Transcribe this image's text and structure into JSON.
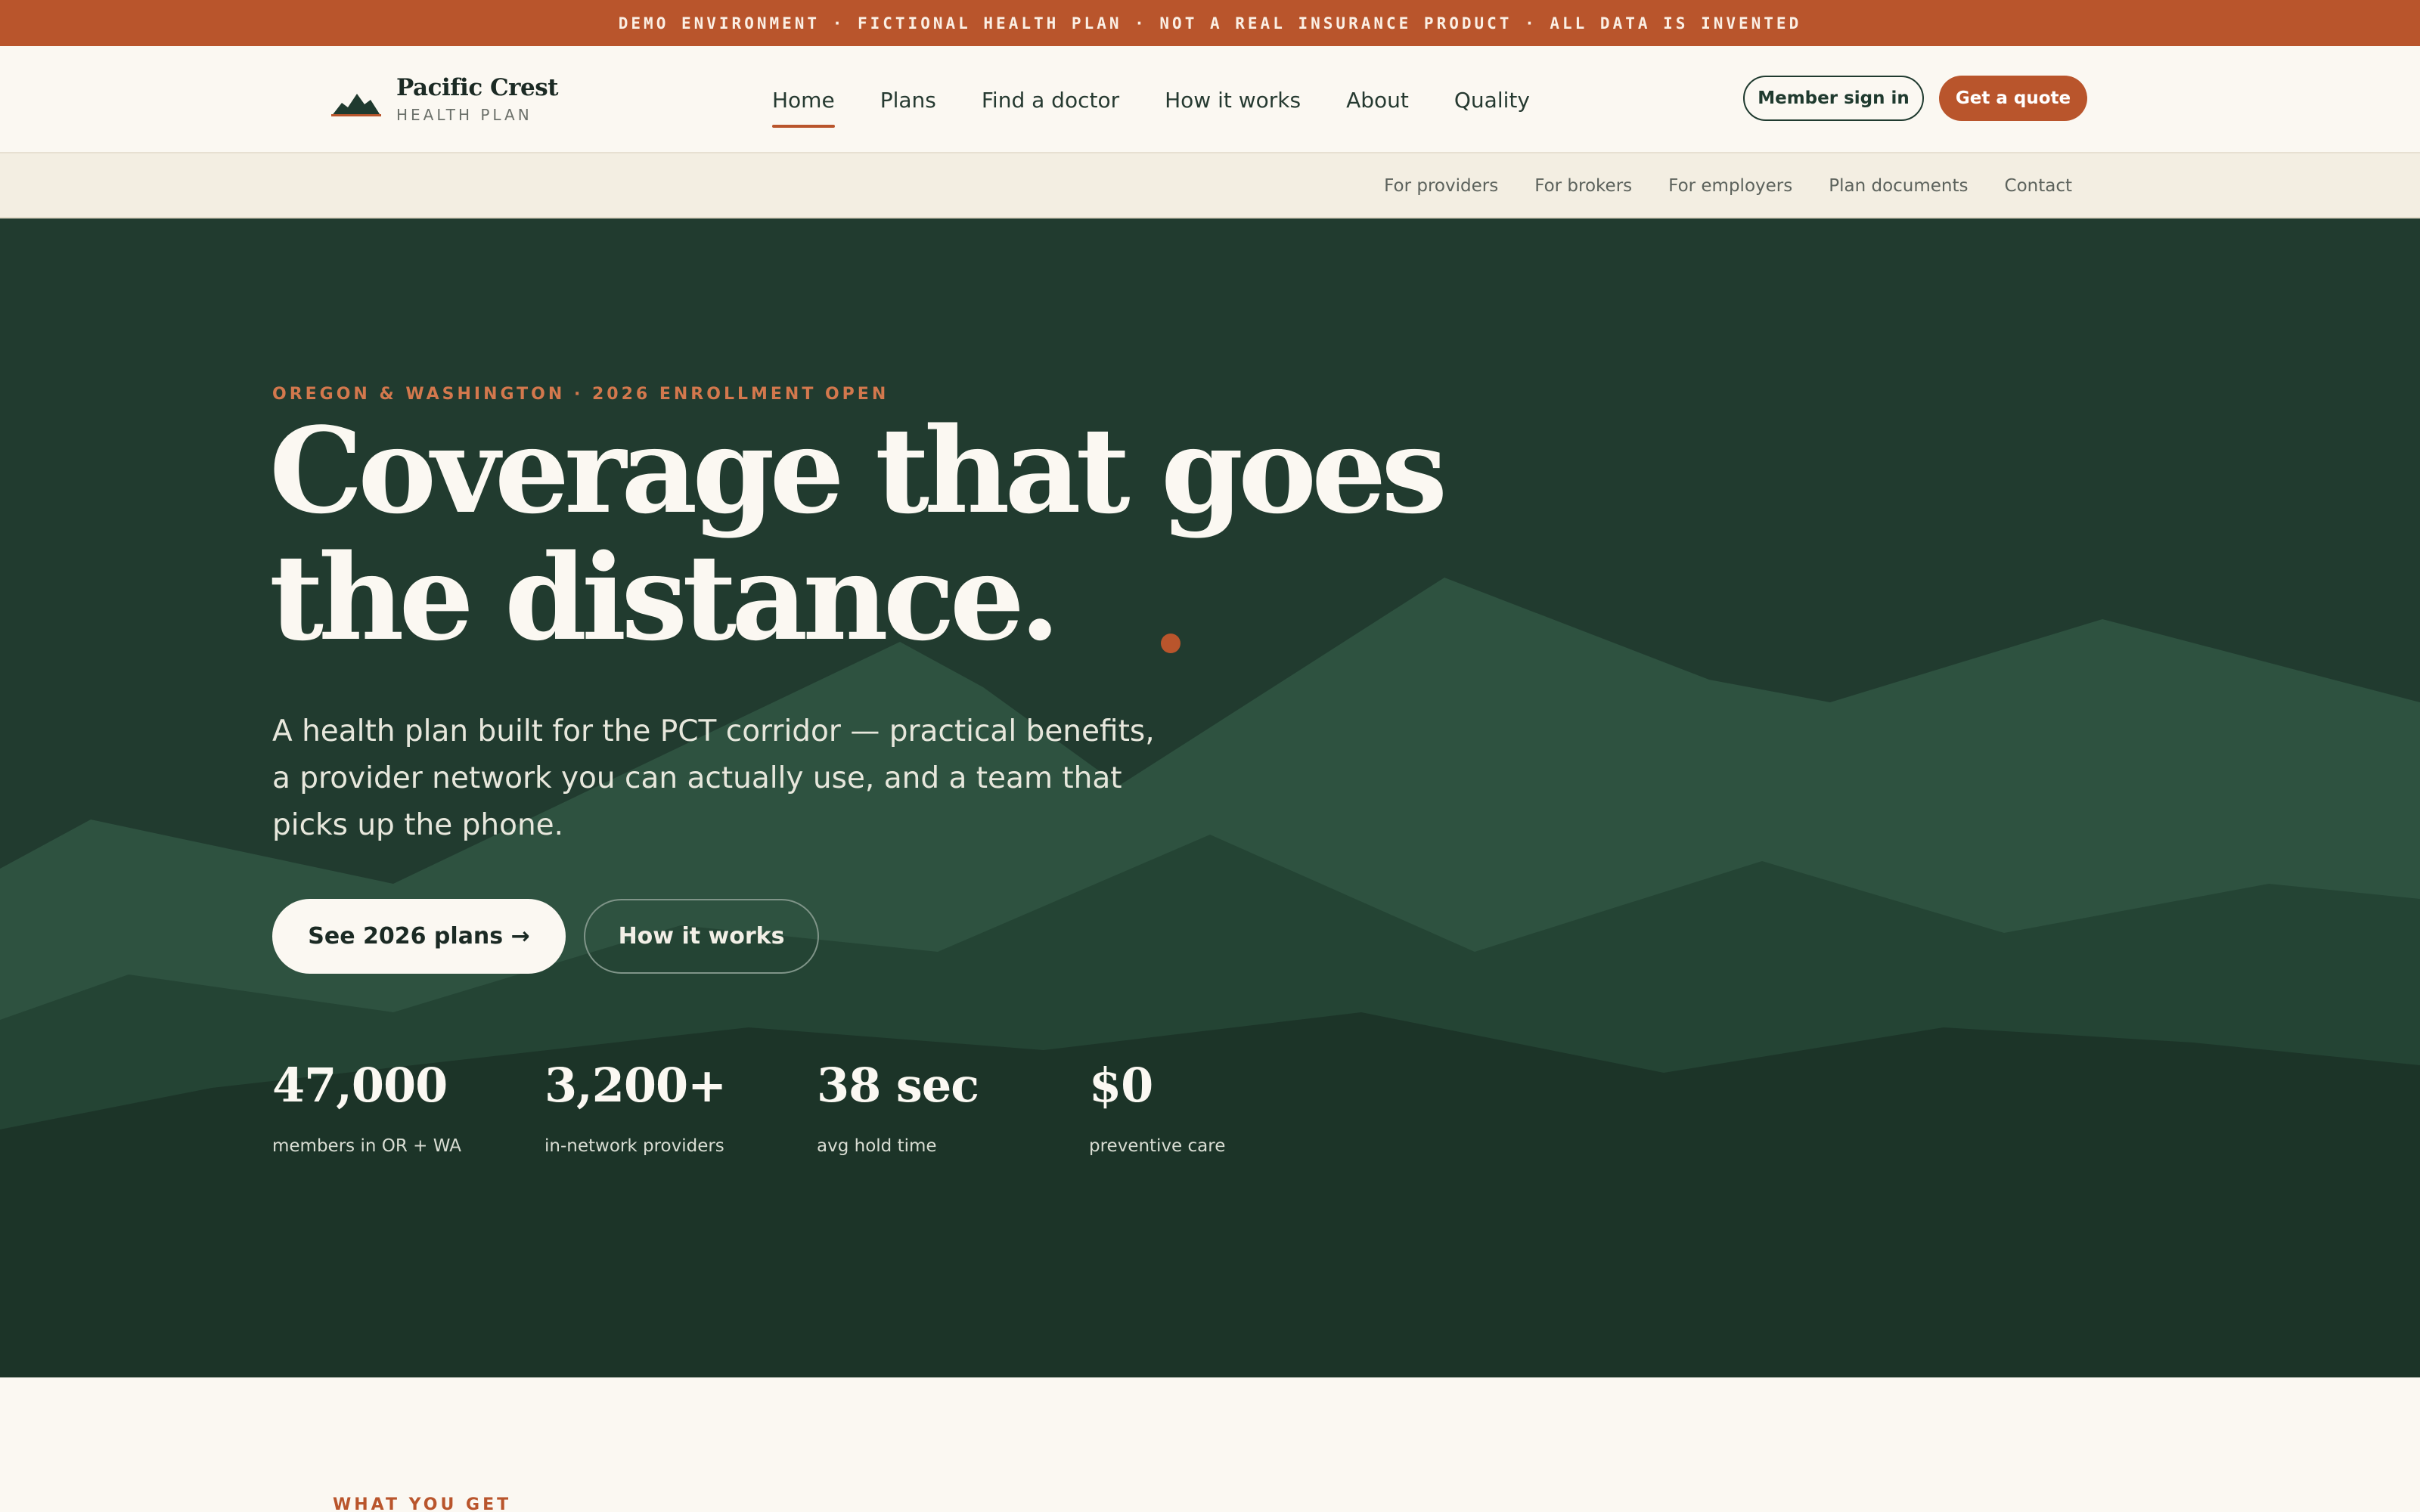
{
  "banner": {
    "text": "DEMO ENVIRONMENT  ·  FICTIONAL HEALTH PLAN  ·  NOT A REAL INSURANCE PRODUCT  ·  ALL DATA IS INVENTED"
  },
  "brand": {
    "name": "Pacific Crest",
    "sub": "HEALTH PLAN",
    "logo_icon": "mountain-icon"
  },
  "nav": {
    "items": [
      {
        "label": "Home",
        "active": true
      },
      {
        "label": "Plans"
      },
      {
        "label": "Find a doctor"
      },
      {
        "label": "How it works"
      },
      {
        "label": "About"
      },
      {
        "label": "Quality"
      }
    ],
    "member_signin": "Member sign in",
    "get_quote": "Get a quote"
  },
  "utility_nav": {
    "items": [
      "For providers",
      "For brokers",
      "For employers",
      "Plan documents",
      "Contact"
    ]
  },
  "hero": {
    "eyebrow": "OREGON & WASHINGTON · 2026 ENROLLMENT OPEN",
    "headline_line1": "Coverage that goes",
    "headline_line2": "the distance.",
    "lede": "A health plan built for the PCT corridor — practical benefits, a provider network you can actually use, and a team that picks up the phone.",
    "primary_cta": "See 2026 plans →",
    "secondary_cta": "How it works",
    "stats": [
      {
        "value": "47,000",
        "label": "members in OR + WA"
      },
      {
        "value": "3,200+",
        "label": "in-network providers"
      },
      {
        "value": "38 sec",
        "label": "avg hold time"
      },
      {
        "value": "$0",
        "label": "preventive care"
      }
    ]
  },
  "next_section": {
    "label": "WHAT YOU GET"
  },
  "colors": {
    "accent": "#b9552c",
    "hero_bg": "#213b2f",
    "cream": "#fbf8f2"
  }
}
